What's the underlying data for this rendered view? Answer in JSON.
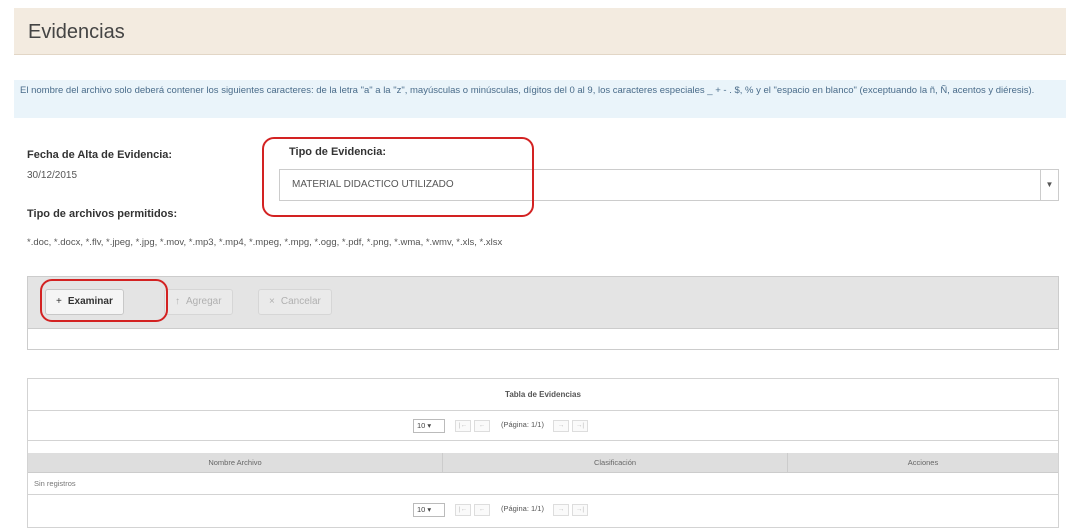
{
  "header": {
    "title": "Evidencias"
  },
  "notice": {
    "text": "El nombre del archivo solo deberá contener los siguientes caracteres: de la letra \"a\" a la \"z\", mayúsculas o minúsculas, dígitos del 0 al 9, los caracteres especiales _ + - . $, % y el \"espacio en blanco\" (exceptuando la ñ, Ñ, acentos y diéresis)."
  },
  "form": {
    "fecha_label": "Fecha de Alta de Evidencia:",
    "fecha_value": "30/12/2015",
    "tipo_label": "Tipo de Evidencia:",
    "tipo_selected": "MATERIAL DIDACTICO UTILIZADO",
    "archivos_label": "Tipo de archivos permitidos:",
    "archivos_value": "*.doc, *.docx, *.flv, *.jpeg, *.jpg, *.mov, *.mp3, *.mp4, *.mpeg, *.mpg, *.ogg, *.pdf, *.png, *.wma, *.wmv, *.xls, *.xlsx"
  },
  "uploader": {
    "browse_label": "Examinar",
    "add_label": "Agregar",
    "cancel_label": "Cancelar"
  },
  "table": {
    "caption": "Tabla de Evidencias",
    "rows_per_page": "10",
    "page_report": "(Página: 1/1)",
    "columns": [
      "Nombre Archivo",
      "Clasificación",
      "Acciones"
    ],
    "empty_message": "Sin registros"
  },
  "colors": {
    "highlight": "#d32222",
    "header_bg": "#f3ebe0",
    "notice_bg": "#eaf4fa"
  }
}
